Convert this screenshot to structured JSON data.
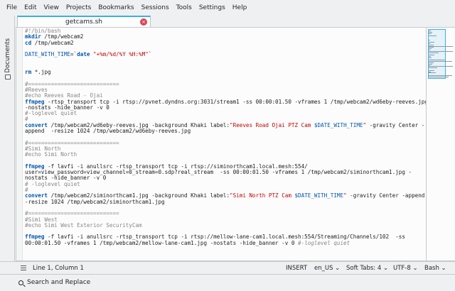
{
  "menu": [
    "File",
    "Edit",
    "View",
    "Projects",
    "Bookmarks",
    "Sessions",
    "Tools",
    "Settings",
    "Help"
  ],
  "sidebar": {
    "documents_label": "Documents"
  },
  "tab": {
    "title": "getcams.sh",
    "close_icon": "close-icon"
  },
  "code_lines": [
    [
      [
        "c-com",
        "#!/bin/bash"
      ]
    ],
    [
      [
        "c-kw",
        "mkdir"
      ],
      [
        "",
        " /tmp/webcam2"
      ]
    ],
    [
      [
        "c-kw",
        "cd"
      ],
      [
        "",
        " /tmp/webcam2"
      ]
    ],
    [
      [
        "",
        ""
      ]
    ],
    [
      [
        "c-var",
        "DATE_WITH_TIME"
      ],
      [
        "",
        "=`"
      ],
      [
        "c-kw",
        "date"
      ],
      [
        "",
        " "
      ],
      [
        "c-str",
        "\"+%m/%d/%Y %H:%M\""
      ],
      [
        "",
        "`"
      ]
    ],
    [
      [
        "",
        ""
      ]
    ],
    [
      [
        "",
        ""
      ]
    ],
    [
      [
        "c-kw",
        "rm"
      ],
      [
        "",
        " *.jpg"
      ]
    ],
    [
      [
        "",
        ""
      ]
    ],
    [
      [
        "c-com",
        "#============================"
      ]
    ],
    [
      [
        "c-com",
        "#Reeves"
      ]
    ],
    [
      [
        "c-com",
        "#echo Reeves Road - Ojai"
      ]
    ],
    [
      [
        "c-kw",
        "ffmpeg"
      ],
      [
        "",
        " -rtsp_transport tcp -i rtsp://pvnet.dyndns.org:3031/stream1 -ss 00:00:01.50 -vframes 1 /tmp/webcam2/wd6eby-reeves.jpg"
      ]
    ],
    [
      [
        "",
        "-nostats -hide_banner -v 0"
      ]
    ],
    [
      [
        "c-com",
        "#-loglevel quiet"
      ]
    ],
    [
      [
        "c-com",
        "#"
      ]
    ],
    [
      [
        "c-kw",
        "convert"
      ],
      [
        "",
        " /tmp/webcam2/wd6eby-reeves.jpg -background Khaki label:"
      ],
      [
        "c-str",
        "\"Reeves Road Ojai PTZ Cam "
      ],
      [
        "c-var",
        "$DATE_WITH_TIME"
      ],
      [
        "c-str",
        "\""
      ],
      [
        "",
        " -gravity Center -"
      ]
    ],
    [
      [
        "",
        "append  -resize 1024 /tmp/webcam2/wd6eby-reeves.jpg"
      ]
    ],
    [
      [
        "",
        ""
      ]
    ],
    [
      [
        "c-com",
        "#============================"
      ]
    ],
    [
      [
        "c-com",
        "#Simi North"
      ]
    ],
    [
      [
        "c-com",
        "#echo Simi North"
      ]
    ],
    [
      [
        "",
        ""
      ]
    ],
    [
      [
        "c-kw",
        "ffmpeg"
      ],
      [
        "",
        " -f lavfi -i anullsrc -rtsp_transport tcp -i rtsp://siminorthcam1.local.mesh:554/"
      ]
    ],
    [
      [
        "",
        "user=view_password=view_channel=0_stream=0.sdp?real_stream  -ss 00:00:01.50 -vframes 1 /tmp/webcam2/siminorthcam1.jpg -"
      ]
    ],
    [
      [
        "",
        "nostats -hide_banner -v 0"
      ]
    ],
    [
      [
        "c-com",
        "# -loglevel quiet"
      ]
    ],
    [
      [
        "c-com",
        "#"
      ]
    ],
    [
      [
        "c-kw",
        "convert"
      ],
      [
        "",
        " /tmp/webcam2/siminorthcam1.jpg -background Khaki label:"
      ],
      [
        "c-str",
        "\"Simi North PTZ Cam "
      ],
      [
        "c-var",
        "$DATE_WITH_TIME"
      ],
      [
        "c-str",
        "\""
      ],
      [
        "",
        " -gravity Center -append"
      ]
    ],
    [
      [
        "",
        "-resize 1024 /tmp/webcam2/siminorthcam1.jpg"
      ]
    ],
    [
      [
        "",
        ""
      ]
    ],
    [
      [
        "c-com",
        "#============================"
      ]
    ],
    [
      [
        "c-com",
        "#Simi West"
      ]
    ],
    [
      [
        "c-com",
        "#echo Simi West Exterior SecurityCam"
      ]
    ],
    [
      [
        "",
        ""
      ]
    ],
    [
      [
        "c-kw",
        "ffmpeg"
      ],
      [
        "",
        " -f lavfi -i anullsrc -rtsp_transport tcp -i rtsp://mellow-lane-cam1.local.mesh:554/Streaming/Channels/102  -ss"
      ]
    ],
    [
      [
        "",
        "00:00:01.50 -vframes 1 /tmp/webcam2/mellow-lane-cam1.jpg -nostats -hide_banner -v 0 "
      ],
      [
        "c-ital",
        "#-loglevel quiet"
      ]
    ]
  ],
  "status": {
    "position": "Line 1, Column 1",
    "mode": "INSERT",
    "language": "en_US",
    "indent": "Soft Tabs: 4",
    "encoding": "UTF-8",
    "syntax": "Bash"
  },
  "bottom": {
    "search_replace": "Search and Replace"
  },
  "colors": {
    "accent": "#3daee9",
    "keyword": "#0057ae",
    "string": "#bf0303",
    "comment": "#898887",
    "close": "#da4453"
  }
}
